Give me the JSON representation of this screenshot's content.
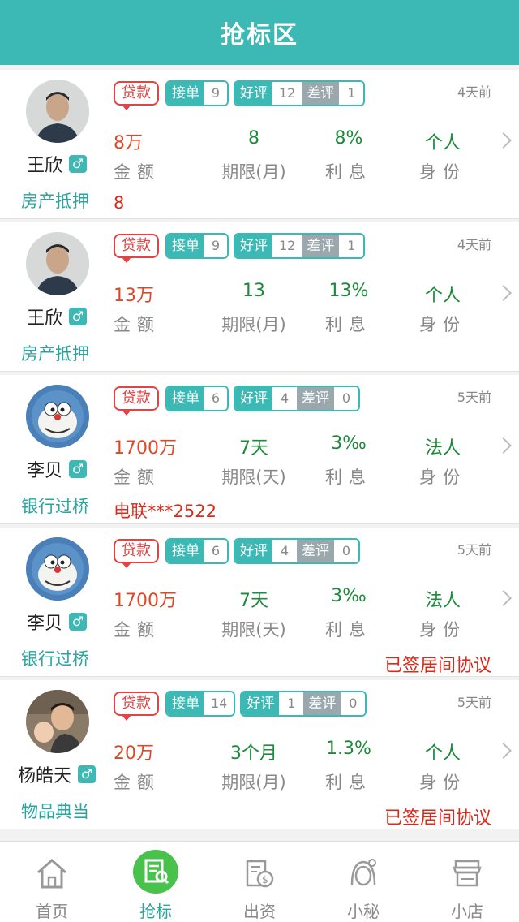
{
  "header": {
    "title": "抢标区"
  },
  "cards": [
    {
      "name": "王欣",
      "gender": "♂",
      "category": "房产抵押",
      "loan_tag": "贷款",
      "badges": {
        "accept_label": "接单",
        "accept": "9",
        "good_label": "好评",
        "good": "12",
        "bad_label": "差评",
        "bad": "1"
      },
      "time": "4天前",
      "amount": "8万",
      "period": "8",
      "rate": "8%",
      "identity": "个人",
      "labels": {
        "amount": "金额",
        "period": "期限(月)",
        "rate": "利息",
        "identity": "身份"
      },
      "note": "8",
      "agreement": ""
    },
    {
      "name": "王欣",
      "gender": "♂",
      "category": "房产抵押",
      "loan_tag": "贷款",
      "badges": {
        "accept_label": "接单",
        "accept": "9",
        "good_label": "好评",
        "good": "12",
        "bad_label": "差评",
        "bad": "1"
      },
      "time": "4天前",
      "amount": "13万",
      "period": "13",
      "rate": "13%",
      "identity": "个人",
      "labels": {
        "amount": "金额",
        "period": "期限(月)",
        "rate": "利息",
        "identity": "身份"
      },
      "note": "",
      "agreement": ""
    },
    {
      "name": "李贝",
      "gender": "♂",
      "category": "银行过桥",
      "loan_tag": "贷款",
      "badges": {
        "accept_label": "接单",
        "accept": "6",
        "good_label": "好评",
        "good": "4",
        "bad_label": "差评",
        "bad": "0"
      },
      "time": "5天前",
      "amount": "1700万",
      "period": "7天",
      "rate": "3‰",
      "identity": "法人",
      "labels": {
        "amount": "金额",
        "period": "期限(天)",
        "rate": "利息",
        "identity": "身份"
      },
      "note": "电联***2522",
      "agreement": ""
    },
    {
      "name": "李贝",
      "gender": "♂",
      "category": "银行过桥",
      "loan_tag": "贷款",
      "badges": {
        "accept_label": "接单",
        "accept": "6",
        "good_label": "好评",
        "good": "4",
        "bad_label": "差评",
        "bad": "0"
      },
      "time": "5天前",
      "amount": "1700万",
      "period": "7天",
      "rate": "3‰",
      "identity": "法人",
      "labels": {
        "amount": "金额",
        "period": "期限(天)",
        "rate": "利息",
        "identity": "身份"
      },
      "note": "",
      "agreement": "已签居间协议"
    },
    {
      "name": "杨皓天",
      "gender": "♂",
      "category": "物品典当",
      "loan_tag": "贷款",
      "badges": {
        "accept_label": "接单",
        "accept": "14",
        "good_label": "好评",
        "good": "1",
        "bad_label": "差评",
        "bad": "0"
      },
      "time": "5天前",
      "amount": "20万",
      "period": "3个月",
      "rate": "1.3%",
      "identity": "个人",
      "labels": {
        "amount": "金额",
        "period": "期限(月)",
        "rate": "利息",
        "identity": "身份"
      },
      "note": "",
      "agreement": "已签居间协议"
    }
  ],
  "tabbar": {
    "items": [
      {
        "label": "首页",
        "icon": "home-icon",
        "active": false
      },
      {
        "label": "抢标",
        "icon": "bid-icon",
        "active": true
      },
      {
        "label": "出资",
        "icon": "invest-icon",
        "active": false
      },
      {
        "label": "小秘",
        "icon": "secretary-icon",
        "active": false
      },
      {
        "label": "小店",
        "icon": "shop-icon",
        "active": false
      }
    ]
  },
  "colors": {
    "primary": "#3cb9b5",
    "danger": "#d94a2a",
    "value_green": "#1d8a3a",
    "active_tab": "#48c24a"
  }
}
